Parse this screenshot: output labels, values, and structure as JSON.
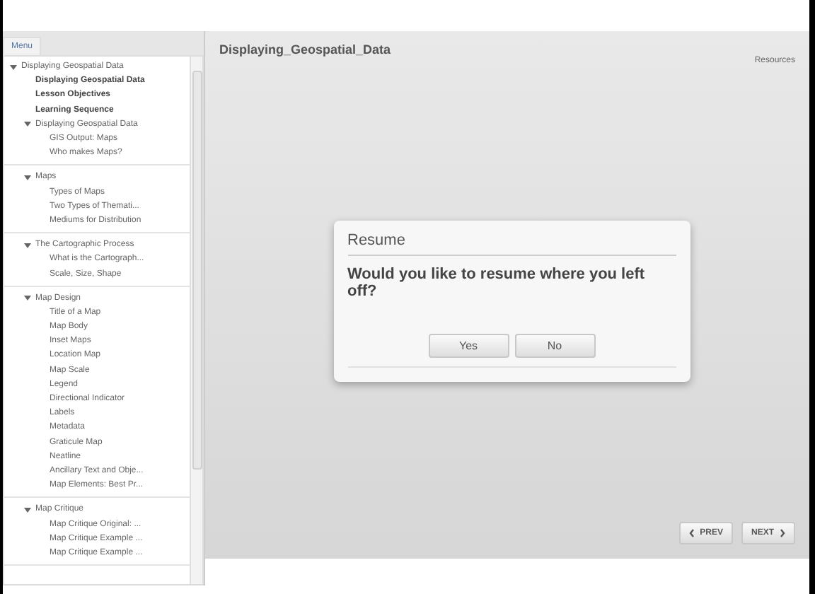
{
  "sidebar": {
    "tab": "Menu",
    "tree": [
      {
        "label": "Displaying Geospatial Data",
        "expanded": true,
        "children": [
          {
            "label": "Displaying Geospatial Data"
          },
          {
            "label": "Lesson Objectives"
          },
          {
            "label": "Learning Sequence"
          },
          {
            "label": "Displaying Geospatial Data",
            "expanded": true,
            "children": [
              {
                "label": "GIS Output: Maps"
              },
              {
                "label": "Who makes Maps?"
              }
            ]
          },
          {
            "label": "Maps",
            "expanded": true,
            "children": [
              {
                "label": "Types of Maps"
              },
              {
                "label": "Two Types of Themati..."
              },
              {
                "label": "Mediums for Distribution"
              }
            ]
          },
          {
            "label": "The Cartographic Process",
            "expanded": true,
            "children": [
              {
                "label": "What is the Cartograph..."
              },
              {
                "label": "Scale, Size, Shape"
              }
            ]
          },
          {
            "label": "Map Design",
            "expanded": true,
            "children": [
              {
                "label": "Title of a Map"
              },
              {
                "label": "Map Body"
              },
              {
                "label": "Inset Maps"
              },
              {
                "label": "Location Map"
              },
              {
                "label": "Map Scale"
              },
              {
                "label": "Legend"
              },
              {
                "label": "Directional Indicator"
              },
              {
                "label": "Labels"
              },
              {
                "label": "Metadata"
              },
              {
                "label": "Graticule Map"
              },
              {
                "label": "Neatline"
              },
              {
                "label": "Ancillary Text and Obje..."
              },
              {
                "label": "Map Elements: Best Pr..."
              }
            ]
          },
          {
            "label": "Map Critique",
            "expanded": true,
            "children": [
              {
                "label": "Map Critique Original: ..."
              },
              {
                "label": "Map Critique Example ..."
              },
              {
                "label": "Map Critique Example ..."
              }
            ]
          }
        ]
      }
    ]
  },
  "main": {
    "title": "Displaying_Geospatial_Data",
    "resources": "Resources"
  },
  "dialog": {
    "title": "Resume",
    "message": "Would you like to resume where you left off?",
    "buttons": [
      "Yes",
      "No"
    ]
  },
  "nav": {
    "prev": "PREV",
    "next": "NEXT"
  }
}
